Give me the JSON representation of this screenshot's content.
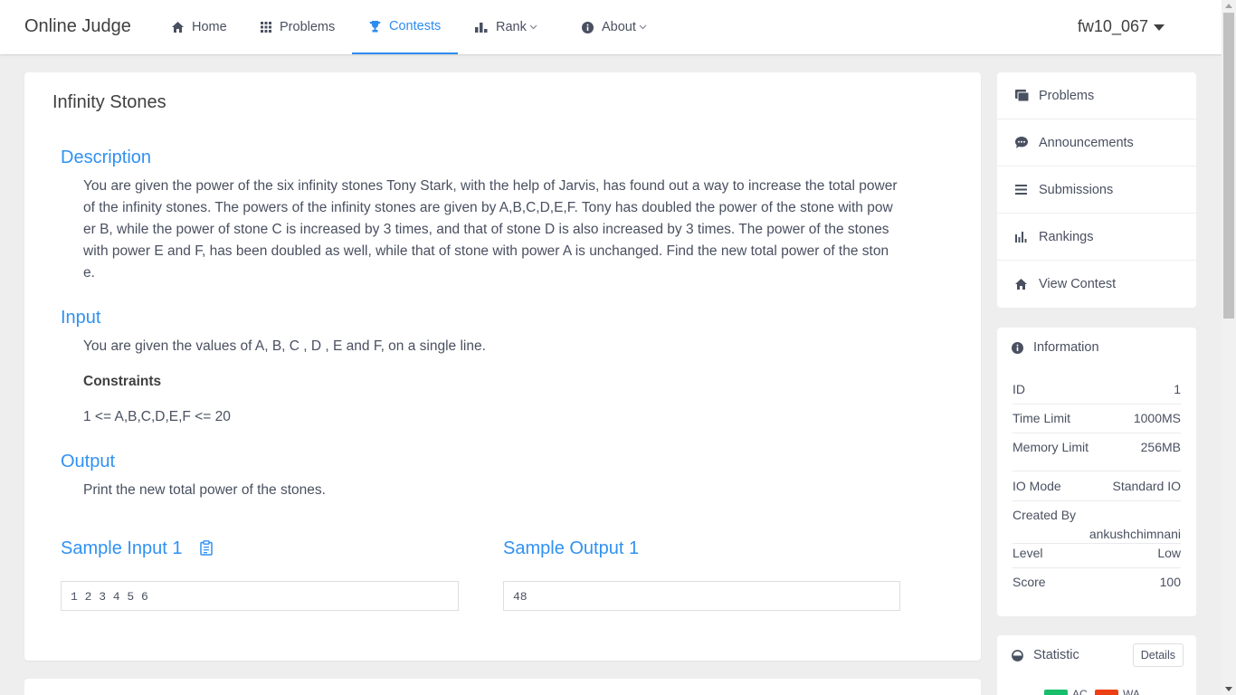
{
  "header": {
    "brand": "Online Judge",
    "nav": [
      {
        "label": "Home"
      },
      {
        "label": "Problems"
      },
      {
        "label": "Contests"
      },
      {
        "label": "Rank"
      },
      {
        "label": "About"
      }
    ],
    "username": "fw10_067",
    "accent": "#2d8cf0"
  },
  "problem": {
    "title": "Infinity Stones",
    "description_title": "Description",
    "description_lines": [
      "You are given the power of the six infinity stones Tony Stark, with the help of Jarvis, has found out a way to increase the total power",
      "of the infinity stones. The powers of the infinity stones are given by A,B,C,D,E,F. Tony has doubled the power of the stone with pow",
      "er B, while the power of stone C is increased by 3 times, and that of stone D is also increased by 3 times. The power of the stones",
      "with power E and F, has been doubled as well, while that of stone with power A is unchanged. Find the new total power of the ston",
      "e."
    ],
    "input_title": "Input",
    "input_text": "You are given the values of A, B, C , D , E and F, on a single line.",
    "constraints_label": "Constraints",
    "constraints_text": "1 <= A,B,C,D,E,F <= 20",
    "output_title": "Output",
    "output_text": "Print the new total power of the stones.",
    "sample_input_title": "Sample Input 1",
    "sample_input": "1 2 3 4 5 6",
    "sample_output_title": "Sample Output 1",
    "sample_output": "48"
  },
  "sidebar": {
    "menu": [
      {
        "label": "Problems"
      },
      {
        "label": "Announcements"
      },
      {
        "label": "Submissions"
      },
      {
        "label": "Rankings"
      },
      {
        "label": "View Contest"
      }
    ],
    "info_title": "Information",
    "info": {
      "id_label": "ID",
      "id_value": "1",
      "time_label": "Time Limit",
      "time_value": "1000MS",
      "mem_label": "Memory Limit",
      "mem_value": "256MB",
      "io_label": "IO Mode",
      "io_value": "Standard IO",
      "created_label": "Created By",
      "created_value": "ankushchimnani",
      "level_label": "Level",
      "level_value": "Low",
      "score_label": "Score",
      "score_value": "100"
    },
    "statistic_title": "Statistic",
    "details_label": "Details",
    "legend": [
      {
        "label": "AC",
        "color": "#19be6b"
      },
      {
        "label": "WA",
        "color": "#ed3f14"
      }
    ]
  }
}
